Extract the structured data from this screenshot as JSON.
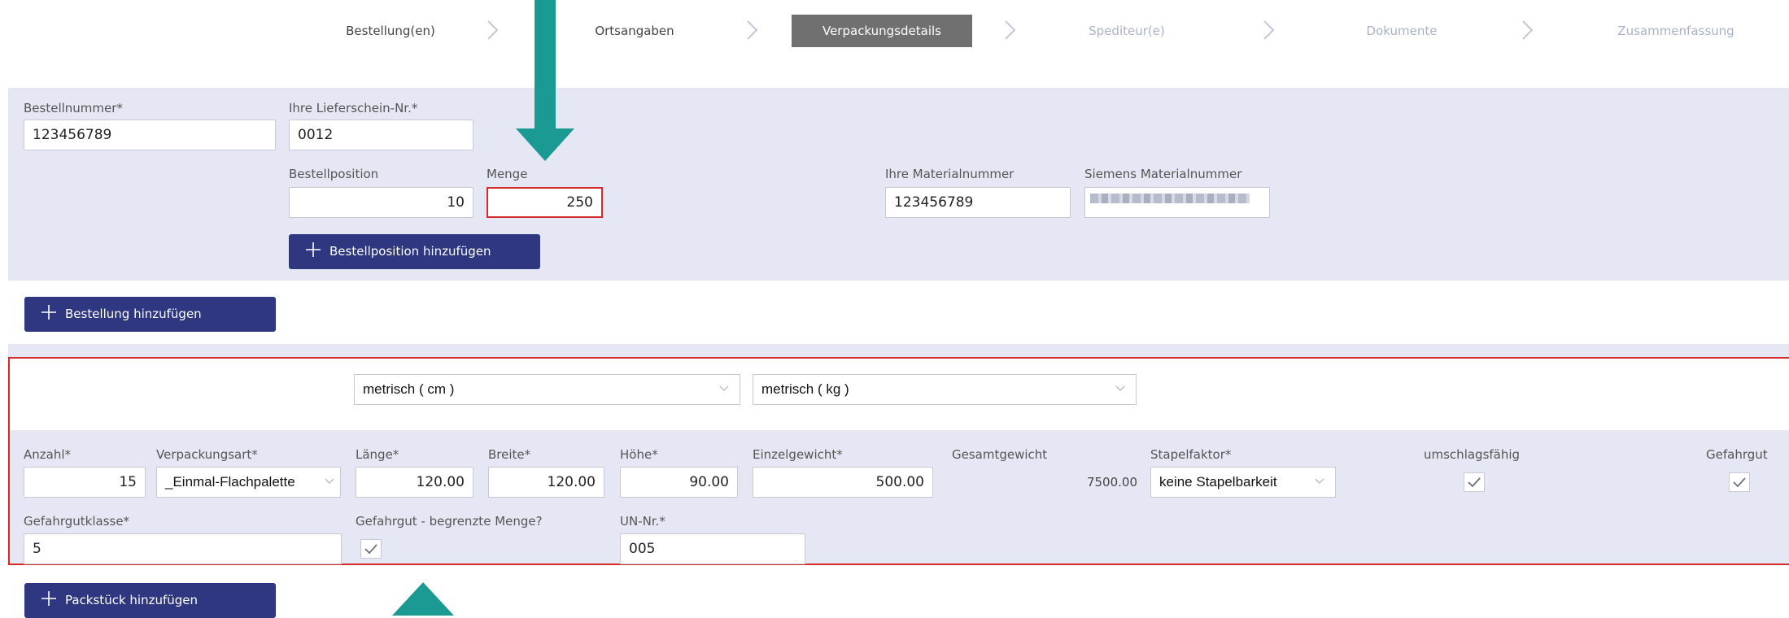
{
  "wizard": {
    "steps": [
      {
        "label": "Bestellung(en)",
        "state": "done"
      },
      {
        "label": "Ortsangaben",
        "state": "done"
      },
      {
        "label": "Verpackungsdetails",
        "state": "active"
      },
      {
        "label": "Spediteur(e)",
        "state": "disabled"
      },
      {
        "label": "Dokumente",
        "state": "disabled"
      },
      {
        "label": "Zusammenfassung",
        "state": "disabled"
      }
    ]
  },
  "order": {
    "order_number_label": "Bestellnummer*",
    "order_number": "123456789",
    "delivery_note_label": "Ihre Lieferschein-Nr.*",
    "delivery_note": "0012",
    "position_label": "Bestellposition",
    "position": "10",
    "quantity_label": "Menge",
    "quantity": "250",
    "your_material_label": "Ihre Materialnummer",
    "your_material": "123456789",
    "siemens_material_label": "Siemens Materialnummer",
    "add_position_button": "Bestellposition hinzufügen"
  },
  "add_order_button": "Bestellung hinzufügen",
  "package": {
    "unit_length": "metrisch ( cm )",
    "unit_weight": "metrisch ( kg )",
    "count_label": "Anzahl*",
    "count": "15",
    "packaging_label": "Verpackungsart*",
    "packaging": "_Einmal-Flachpalette",
    "length_label": "Länge*",
    "length": "120.00",
    "width_label": "Breite*",
    "width": "120.00",
    "height_label": "Höhe*",
    "height": "90.00",
    "unit_weight_label": "Einzelgewicht*",
    "unit_weight_value": "500.00",
    "total_weight_label": "Gesamtgewicht",
    "total_weight": "7500.00",
    "stacking_label": "Stapelfaktor*",
    "stacking": "keine Stapelbarkeit",
    "transshipment_label": "umschlagsfähig",
    "hazardous_label": "Gefahrgut",
    "hazard_class_label": "Gefahrgutklasse*",
    "hazard_class": "5",
    "limited_quantity_label": "Gefahrgut - begrenzte Menge?",
    "un_label": "UN-Nr.*",
    "un_number": "005"
  },
  "add_package_button": "Packstück hinzufügen",
  "colors": {
    "accent_navy": "#2e3780",
    "panel": "#e5e8f4",
    "error": "#d52a2a",
    "arrow": "#1a9a92",
    "step_active": "#707070"
  }
}
